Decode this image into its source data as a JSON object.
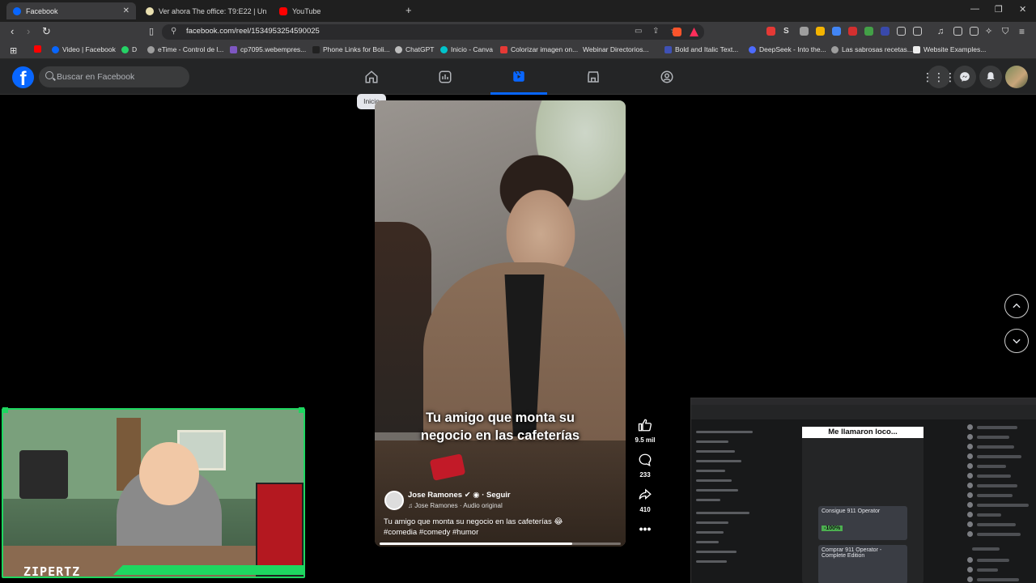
{
  "browser": {
    "tabs": [
      {
        "title": "Facebook",
        "active": true
      },
      {
        "title": "Ver ahora The office: T9:E22 | Un sue",
        "active": false
      },
      {
        "title": "YouTube",
        "active": false
      }
    ],
    "url": "facebook.com/reel/1534953254590025",
    "bookmarks": [
      "Video | Facebook",
      "D",
      "eTime - Control de l...",
      "cp7095.webempres...",
      "Phone Links for Boli...",
      "ChatGPT",
      "Inicio - Canva",
      "Colorizar imagen on...",
      "Webinar Directorios...",
      "Bold and Italic Text...",
      "DeepSeek - Into the...",
      "Las sabrosas recetas...",
      "Website Examples..."
    ]
  },
  "facebook": {
    "search_placeholder": "Buscar en Facebook",
    "nav": [
      "home-icon",
      "feeds-icon",
      "reels-icon",
      "marketplace-icon",
      "groups-icon"
    ],
    "tooltip": "Inicio",
    "brand_color": "#0866ff"
  },
  "reel": {
    "caption": "Tu amigo que monta su negocio en las cafeterías",
    "author": "Jose Ramones",
    "follow": "Seguir",
    "audio": "Jose Ramones · Audio original",
    "description": "Tu amigo que monta su negocio en las cafeterías 😂",
    "hashtags": "#comedia #comedy #humor",
    "likes": "9.5 mil",
    "comments": "233",
    "shares": "410",
    "progress": 0.8
  },
  "stream": {
    "name": "ZIPERTZ",
    "accent": "#1ed760"
  },
  "pip": {
    "header": "Me llamaron loco...",
    "card1_title": "Consigue 911 Operator",
    "card2_title": "Comprar 911 Operator - Complete Edition",
    "badge": "-100%"
  }
}
